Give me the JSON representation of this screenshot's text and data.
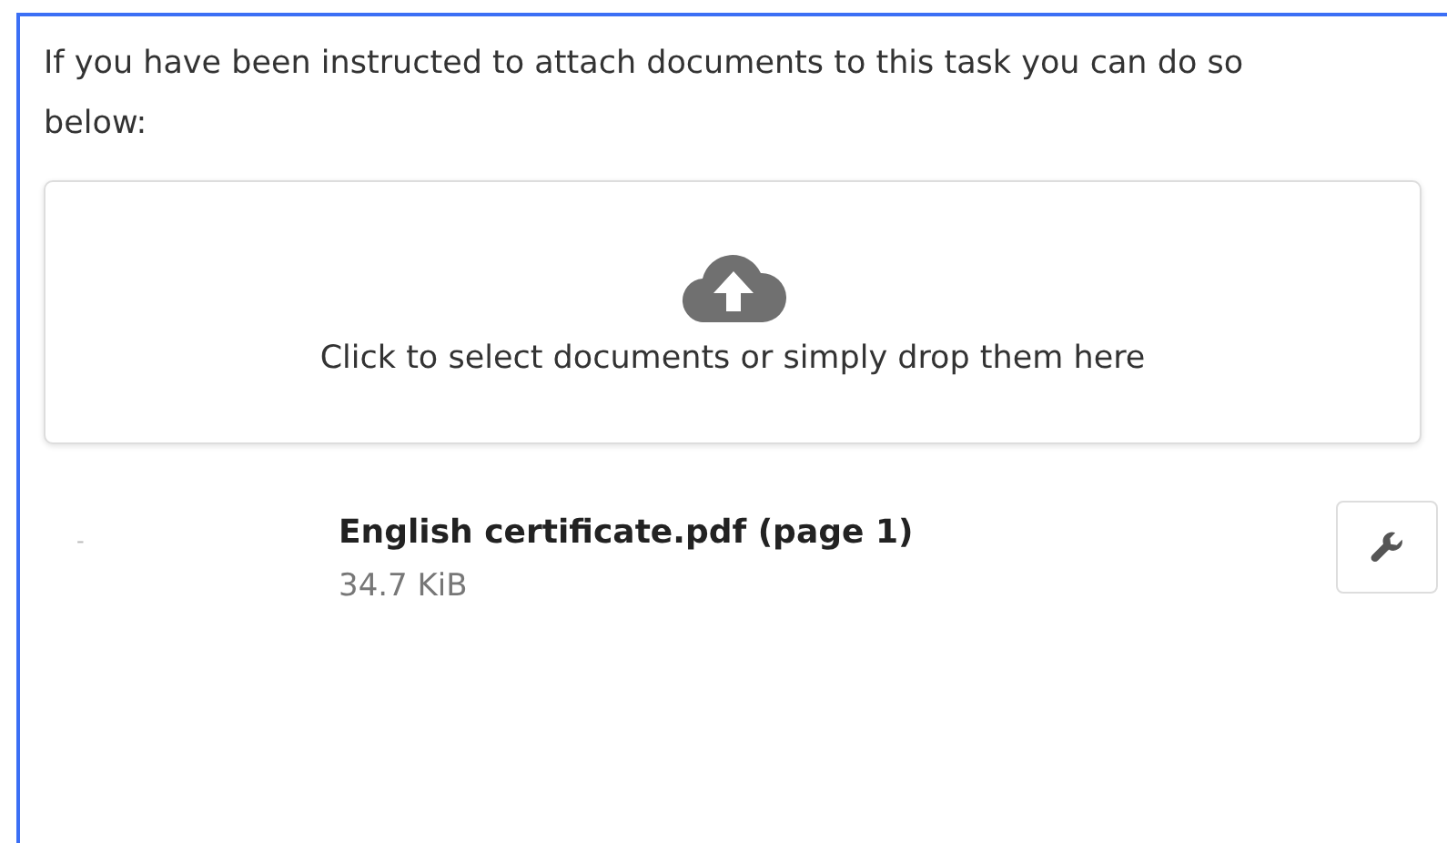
{
  "instructions": "If you have been instructed to attach documents to this task you can do so below:",
  "dropzone": {
    "label": "Click to select documents or simply drop them here"
  },
  "files": [
    {
      "thumbnail": "-",
      "name": "English certificate.pdf (page 1)",
      "size": "34.7 KiB"
    }
  ]
}
